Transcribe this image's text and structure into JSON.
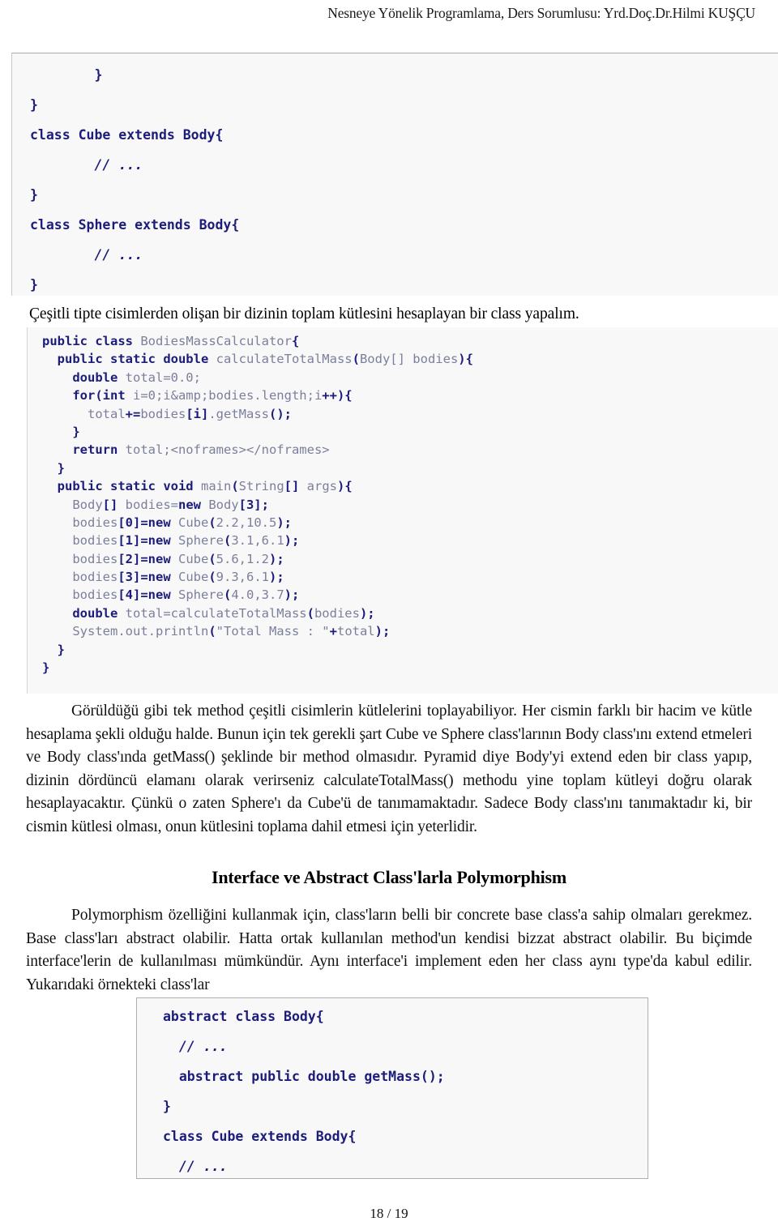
{
  "header": {
    "running_title": "Nesneye Yönelik Programlama,  Ders Sorumlusu: Yrd.Doç.Dr.Hilmi KUŞÇU"
  },
  "code_block_1": {
    "lines": [
      [
        {
          "t": "        }",
          "s": "kw"
        }
      ],
      [
        {
          "t": "}",
          "s": "kw"
        }
      ],
      [
        {
          "t": "class Cube extends Body{",
          "s": "kw"
        }
      ],
      [
        {
          "t": "        ",
          "s": "id"
        },
        {
          "t": "// ...",
          "s": "cm"
        }
      ],
      [
        {
          "t": "}",
          "s": "kw"
        }
      ],
      [
        {
          "t": "class Sphere extends Body{",
          "s": "kw"
        }
      ],
      [
        {
          "t": "        ",
          "s": "id"
        },
        {
          "t": "// ...",
          "s": "cm"
        }
      ],
      [
        {
          "t": "}",
          "s": "kw"
        }
      ]
    ]
  },
  "lead_line": {
    "text": "Çeşitli tipte cisimlerden olişan bir dizinin toplam kütlesini hesaplayan bir class yapalım."
  },
  "code_block_2": {
    "lines": [
      [
        {
          "t": "public class ",
          "s": "kw"
        },
        {
          "t": "BodiesMassCalculator",
          "s": "id"
        },
        {
          "t": "{",
          "s": "kw"
        }
      ],
      [
        {
          "t": "  ",
          "s": "id"
        },
        {
          "t": "public static double ",
          "s": "kw"
        },
        {
          "t": "calculateTotalMass",
          "s": "id"
        },
        {
          "t": "(",
          "s": "kw"
        },
        {
          "t": "Body[] bodies",
          "s": "id"
        },
        {
          "t": "){",
          "s": "kw"
        }
      ],
      [
        {
          "t": "    ",
          "s": "id"
        },
        {
          "t": "double ",
          "s": "kw"
        },
        {
          "t": "total=0.0;",
          "s": "id"
        }
      ],
      [
        {
          "t": "    ",
          "s": "id"
        },
        {
          "t": "for(int ",
          "s": "kw"
        },
        {
          "t": "i=0;i&amp;bodies.length;i",
          "s": "id"
        },
        {
          "t": "++){",
          "s": "kw"
        }
      ],
      [
        {
          "t": "      ",
          "s": "id"
        },
        {
          "t": "total",
          "s": "id"
        },
        {
          "t": "+=",
          "s": "kw"
        },
        {
          "t": "bodies",
          "s": "id"
        },
        {
          "t": "[i]",
          "s": "kw"
        },
        {
          "t": ".getMass",
          "s": "id"
        },
        {
          "t": "();",
          "s": "kw"
        }
      ],
      [
        {
          "t": "    ",
          "s": "id"
        },
        {
          "t": "}",
          "s": "kw"
        }
      ],
      [
        {
          "t": "    ",
          "s": "id"
        },
        {
          "t": "return ",
          "s": "kw"
        },
        {
          "t": "total;<noframes></noframes>",
          "s": "id"
        }
      ],
      [
        {
          "t": "  ",
          "s": "id"
        },
        {
          "t": "}",
          "s": "kw"
        }
      ],
      [
        {
          "t": "  ",
          "s": "id"
        },
        {
          "t": "public static void ",
          "s": "kw"
        },
        {
          "t": "main",
          "s": "id"
        },
        {
          "t": "(",
          "s": "kw"
        },
        {
          "t": "String",
          "s": "id"
        },
        {
          "t": "[] ",
          "s": "kw"
        },
        {
          "t": "args",
          "s": "id"
        },
        {
          "t": "){",
          "s": "kw"
        }
      ],
      [
        {
          "t": "    ",
          "s": "id"
        },
        {
          "t": "Body",
          "s": "id"
        },
        {
          "t": "[] ",
          "s": "kw"
        },
        {
          "t": "bodies=",
          "s": "id"
        },
        {
          "t": "new ",
          "s": "kw"
        },
        {
          "t": "Body",
          "s": "id"
        },
        {
          "t": "[3];",
          "s": "kw"
        }
      ],
      [
        {
          "t": "    ",
          "s": "id"
        },
        {
          "t": "bodies",
          "s": "id"
        },
        {
          "t": "[0]=",
          "s": "kw"
        },
        {
          "t": "",
          "s": "id"
        },
        {
          "t": "new ",
          "s": "kw"
        },
        {
          "t": "Cube",
          "s": "id"
        },
        {
          "t": "(",
          "s": "kw"
        },
        {
          "t": "2.2,10.5",
          "s": "id"
        },
        {
          "t": ");",
          "s": "kw"
        }
      ],
      [
        {
          "t": "    ",
          "s": "id"
        },
        {
          "t": "bodies",
          "s": "id"
        },
        {
          "t": "[1]=",
          "s": "kw"
        },
        {
          "t": "",
          "s": "id"
        },
        {
          "t": "new ",
          "s": "kw"
        },
        {
          "t": "Sphere",
          "s": "id"
        },
        {
          "t": "(",
          "s": "kw"
        },
        {
          "t": "3.1,6.1",
          "s": "id"
        },
        {
          "t": ");",
          "s": "kw"
        }
      ],
      [
        {
          "t": "    ",
          "s": "id"
        },
        {
          "t": "bodies",
          "s": "id"
        },
        {
          "t": "[2]=",
          "s": "kw"
        },
        {
          "t": "",
          "s": "id"
        },
        {
          "t": "new ",
          "s": "kw"
        },
        {
          "t": "Cube",
          "s": "id"
        },
        {
          "t": "(",
          "s": "kw"
        },
        {
          "t": "5.6,1.2",
          "s": "id"
        },
        {
          "t": ");",
          "s": "kw"
        }
      ],
      [
        {
          "t": "    ",
          "s": "id"
        },
        {
          "t": "bodies",
          "s": "id"
        },
        {
          "t": "[3]=",
          "s": "kw"
        },
        {
          "t": "",
          "s": "id"
        },
        {
          "t": "new ",
          "s": "kw"
        },
        {
          "t": "Cube",
          "s": "id"
        },
        {
          "t": "(",
          "s": "kw"
        },
        {
          "t": "9.3,6.1",
          "s": "id"
        },
        {
          "t": ");",
          "s": "kw"
        }
      ],
      [
        {
          "t": "    ",
          "s": "id"
        },
        {
          "t": "bodies",
          "s": "id"
        },
        {
          "t": "[4]=",
          "s": "kw"
        },
        {
          "t": "",
          "s": "id"
        },
        {
          "t": "new ",
          "s": "kw"
        },
        {
          "t": "Sphere",
          "s": "id"
        },
        {
          "t": "(",
          "s": "kw"
        },
        {
          "t": "4.0,3.7",
          "s": "id"
        },
        {
          "t": ");",
          "s": "kw"
        }
      ],
      [
        {
          "t": "    ",
          "s": "id"
        },
        {
          "t": "double ",
          "s": "kw"
        },
        {
          "t": "total=calculateTotalMass",
          "s": "id"
        },
        {
          "t": "(",
          "s": "kw"
        },
        {
          "t": "bodies",
          "s": "id"
        },
        {
          "t": ");",
          "s": "kw"
        }
      ],
      [
        {
          "t": "    ",
          "s": "id"
        },
        {
          "t": "System.out.println",
          "s": "id"
        },
        {
          "t": "(",
          "s": "kw"
        },
        {
          "t": "\"Total Mass : \"",
          "s": "id"
        },
        {
          "t": "+",
          "s": "kw"
        },
        {
          "t": "total",
          "s": "id"
        },
        {
          "t": ");",
          "s": "kw"
        }
      ],
      [
        {
          "t": "  ",
          "s": "id"
        },
        {
          "t": "}",
          "s": "kw"
        }
      ],
      [
        {
          "t": "}",
          "s": "kw"
        }
      ]
    ]
  },
  "paragraph_1": {
    "text": "Görüldüğü gibi tek method çeşitli cisimlerin kütlelerini toplayabiliyor. Her cismin farklı bir hacim ve kütle hesaplama şekli olduğu halde. Bunun için tek gerekli şart Cube ve Sphere class'larının Body class'ını extend etmeleri ve Body class'ında getMass() şeklinde bir method olmasıdır. Pyramid diye Body'yi extend eden bir class yapıp, dizinin dördüncü elamanı olarak verirseniz calculateTotalMass() methodu yine toplam kütleyi doğru olarak hesaplayacaktır. Çünkü o zaten Sphere'ı da Cube'ü de tanımamaktadır. Sadece Body class'ını tanımaktadır ki, bir cismin kütlesi olması, onun kütlesini toplama dahil etmesi için yeterlidir."
  },
  "section_heading": {
    "text": "Interface ve Abstract Class'larla Polymorphism"
  },
  "paragraph_2": {
    "text": "Polymorphism özelliğini kullanmak için, class'ların belli bir concrete base class'a sahip olmaları gerekmez. Base class'ları abstract olabilir. Hatta ortak kullanılan method'un kendisi bizzat abstract olabilir. Bu biçimde interface'lerin de kullanılması mümkündür. Aynı interface'i implement eden her class aynı type'da kabul edilir. Yukarıdaki örnekteki class'lar"
  },
  "code_block_3": {
    "lines": [
      [
        {
          "t": "abstract class Body{",
          "s": "kw"
        }
      ],
      [
        {
          "t": "  ",
          "s": "id"
        },
        {
          "t": "// ...",
          "s": "cm"
        }
      ],
      [
        {
          "t": "  abstract public double getMass();",
          "s": "kw"
        }
      ],
      [
        {
          "t": "}",
          "s": "kw"
        }
      ],
      [
        {
          "t": "class Cube extends Body{",
          "s": "kw"
        }
      ],
      [
        {
          "t": "  ",
          "s": "id"
        },
        {
          "t": "// ...",
          "s": "cm"
        }
      ]
    ]
  },
  "footer": {
    "page_label": "18 / 19"
  },
  "colors": {
    "keyword": "#1c1c7a",
    "identifier": "#7c7f9b",
    "code_background": "#f8f8f8",
    "code_border": "#b0b0b0",
    "body_text": "#111111"
  }
}
